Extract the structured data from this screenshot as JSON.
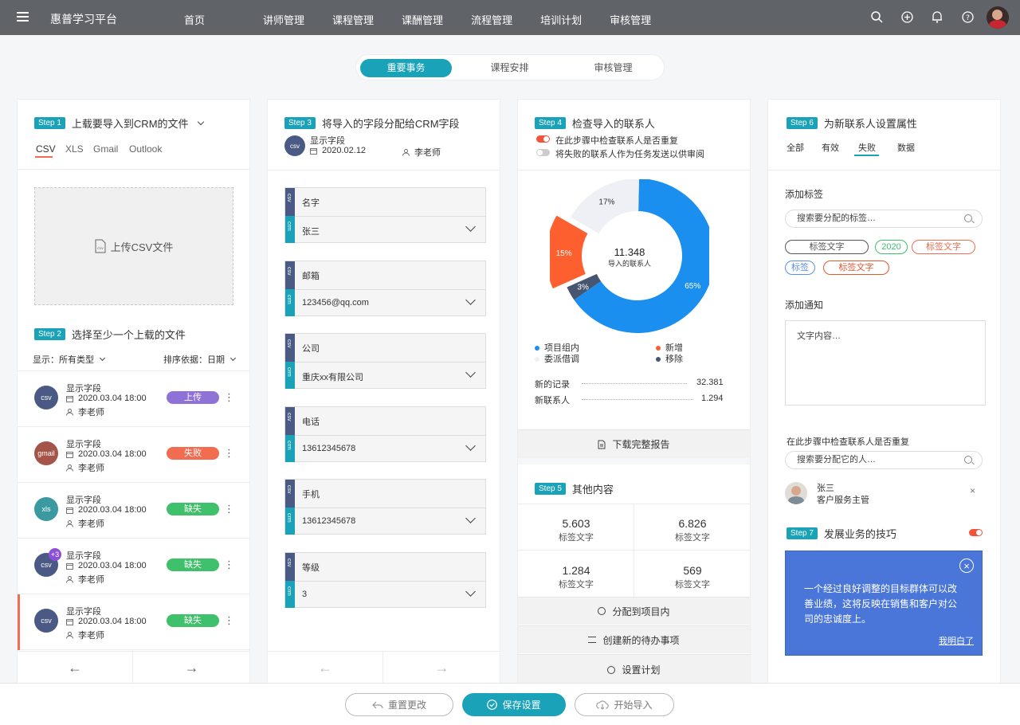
{
  "app": {
    "title": "惠普学习平台"
  },
  "nav": [
    "首页",
    "讲师管理",
    "课程管理",
    "课酬管理",
    "流程管理",
    "培训计划",
    "审核管理"
  ],
  "tabs": [
    "重要事务",
    "课程安排",
    "审核管理"
  ],
  "col1": {
    "step1": "Step 1",
    "step1_title": "上载要导入到CRM的文件",
    "filetabs": [
      "CSV",
      "XLS",
      "Gmail",
      "Outlook"
    ],
    "upload_label": "上传CSV文件",
    "step2": "Step 2",
    "step2_title": "选择至少一个上载的文件",
    "filter_label": "显示：所有类型",
    "sort_label": "排序依据：日期",
    "files": [
      {
        "type": "csv",
        "name": "显示字段",
        "date": "2020.03.04 18:00",
        "user": "李老师",
        "status": "上传",
        "color": "#8e72d8",
        "circle": "#4a5a84"
      },
      {
        "type": "gmail",
        "name": "显示字段",
        "date": "2020.03.04 18:00",
        "user": "李老师",
        "status": "失败",
        "color": "#f26c4f",
        "circle": "#a55449"
      },
      {
        "type": "xls",
        "name": "显示字段",
        "date": "2020.03.04 18:00",
        "user": "李老师",
        "status": "缺失",
        "color": "#3fc06a",
        "circle": "#3a9a9f"
      },
      {
        "type": "csv",
        "name": "显示字段",
        "date": "2020.03.04 18:00",
        "user": "李老师",
        "status": "缺失",
        "color": "#3fc06a",
        "circle": "#4a5a84",
        "extra": "+3"
      },
      {
        "type": "csv",
        "name": "显示字段",
        "date": "2020.03.04 18:00",
        "user": "李老师",
        "status": "缺失",
        "color": "#3fc06a",
        "circle": "#4a5a84"
      }
    ]
  },
  "col2": {
    "step3": "Step 3",
    "step3_title": "将导入的字段分配给CRM字段",
    "file_type": "csv",
    "file_name": "显示字段",
    "file_date": "2020.02.12",
    "file_user": "李老师",
    "strip_top": "csv",
    "strip_bottom": "crm",
    "fields": [
      {
        "label": "名字",
        "value": "张三"
      },
      {
        "label": "邮箱",
        "value": "123456@qq.com"
      },
      {
        "label": "公司",
        "value": "重庆xx有限公司"
      },
      {
        "label": "电话",
        "value": "13612345678"
      },
      {
        "label": "手机",
        "value": "13612345678"
      },
      {
        "label": "等级",
        "value": "3"
      }
    ]
  },
  "col3": {
    "step4": "Step 4",
    "step4_title": "检查导入的联系人",
    "check1": "在此步骤中检查联系人是否重复",
    "check2": "将失败的联系人作为任务发送以供审阅",
    "donut_center_value": "11.348",
    "donut_center_label": "导入的联系人",
    "legend": [
      {
        "name": "项目组内",
        "color": "#1a8fef"
      },
      {
        "name": "新增",
        "color": "#fe5f2f"
      },
      {
        "name": "委派借调",
        "color": "#eef0f5"
      },
      {
        "name": "移除",
        "color": "#475670"
      }
    ],
    "records": [
      {
        "label": "新的记录",
        "value": "32.381"
      },
      {
        "label": "新联系人",
        "value": "1.294"
      }
    ],
    "download": "下载完整报告",
    "step5": "Step 5",
    "step5_title": "其他内容",
    "stats": [
      {
        "value": "5.603",
        "label": "标签文字"
      },
      {
        "value": "6.826",
        "label": "标签文字"
      },
      {
        "value": "1.284",
        "label": "标签文字"
      },
      {
        "value": "569",
        "label": "标签文字"
      }
    ],
    "actions": [
      "分配到项目内",
      "创建新的待办事项",
      "设置计划"
    ]
  },
  "chart_data": {
    "type": "pie",
    "title": "",
    "center_value": "11.348",
    "center_label": "导入的联系人",
    "categories": [
      "项目组内",
      "移除",
      "新增",
      "委派借调"
    ],
    "values": [
      65,
      3,
      15,
      17
    ],
    "labels": [
      "65%",
      "3%",
      "15%",
      "17%"
    ],
    "colors": [
      "#1a8fef",
      "#475670",
      "#fe5f2f",
      "#eef0f5"
    ]
  },
  "col4": {
    "step6": "Step 6",
    "step6_title": "为新联系人设置属性",
    "tabs": [
      "全部",
      "有效",
      "失败",
      "数据"
    ],
    "tag_label": "添加标签",
    "tag_search": "搜索要分配的标签…",
    "tags": [
      {
        "text": "标签文字",
        "color": "#555"
      },
      {
        "text": "2020",
        "color": "#3fc06a"
      },
      {
        "text": "标签文字",
        "color": "#f26c4f"
      },
      {
        "text": "标签",
        "color": "#5b8fe0"
      },
      {
        "text": "标签文字",
        "color": "#e2582f"
      }
    ],
    "notify_label": "添加通知",
    "notify_placeholder": "文字内容…",
    "dup_label": "在此步骤中检查联系人是否重复",
    "person_search": "搜索要分配它的人…",
    "person_name": "张三",
    "person_role": "客户服务主管",
    "step7": "Step 7",
    "step7_title": "发展业务的技巧",
    "tip_text": "一个经过良好调整的目标群体可以改善业绩，这将反映在销售和客户对公司的忠诚度上。",
    "tip_link": "我明白了"
  },
  "bottom": {
    "reset": "重置更改",
    "save": "保存设置",
    "import": "开始导入"
  }
}
